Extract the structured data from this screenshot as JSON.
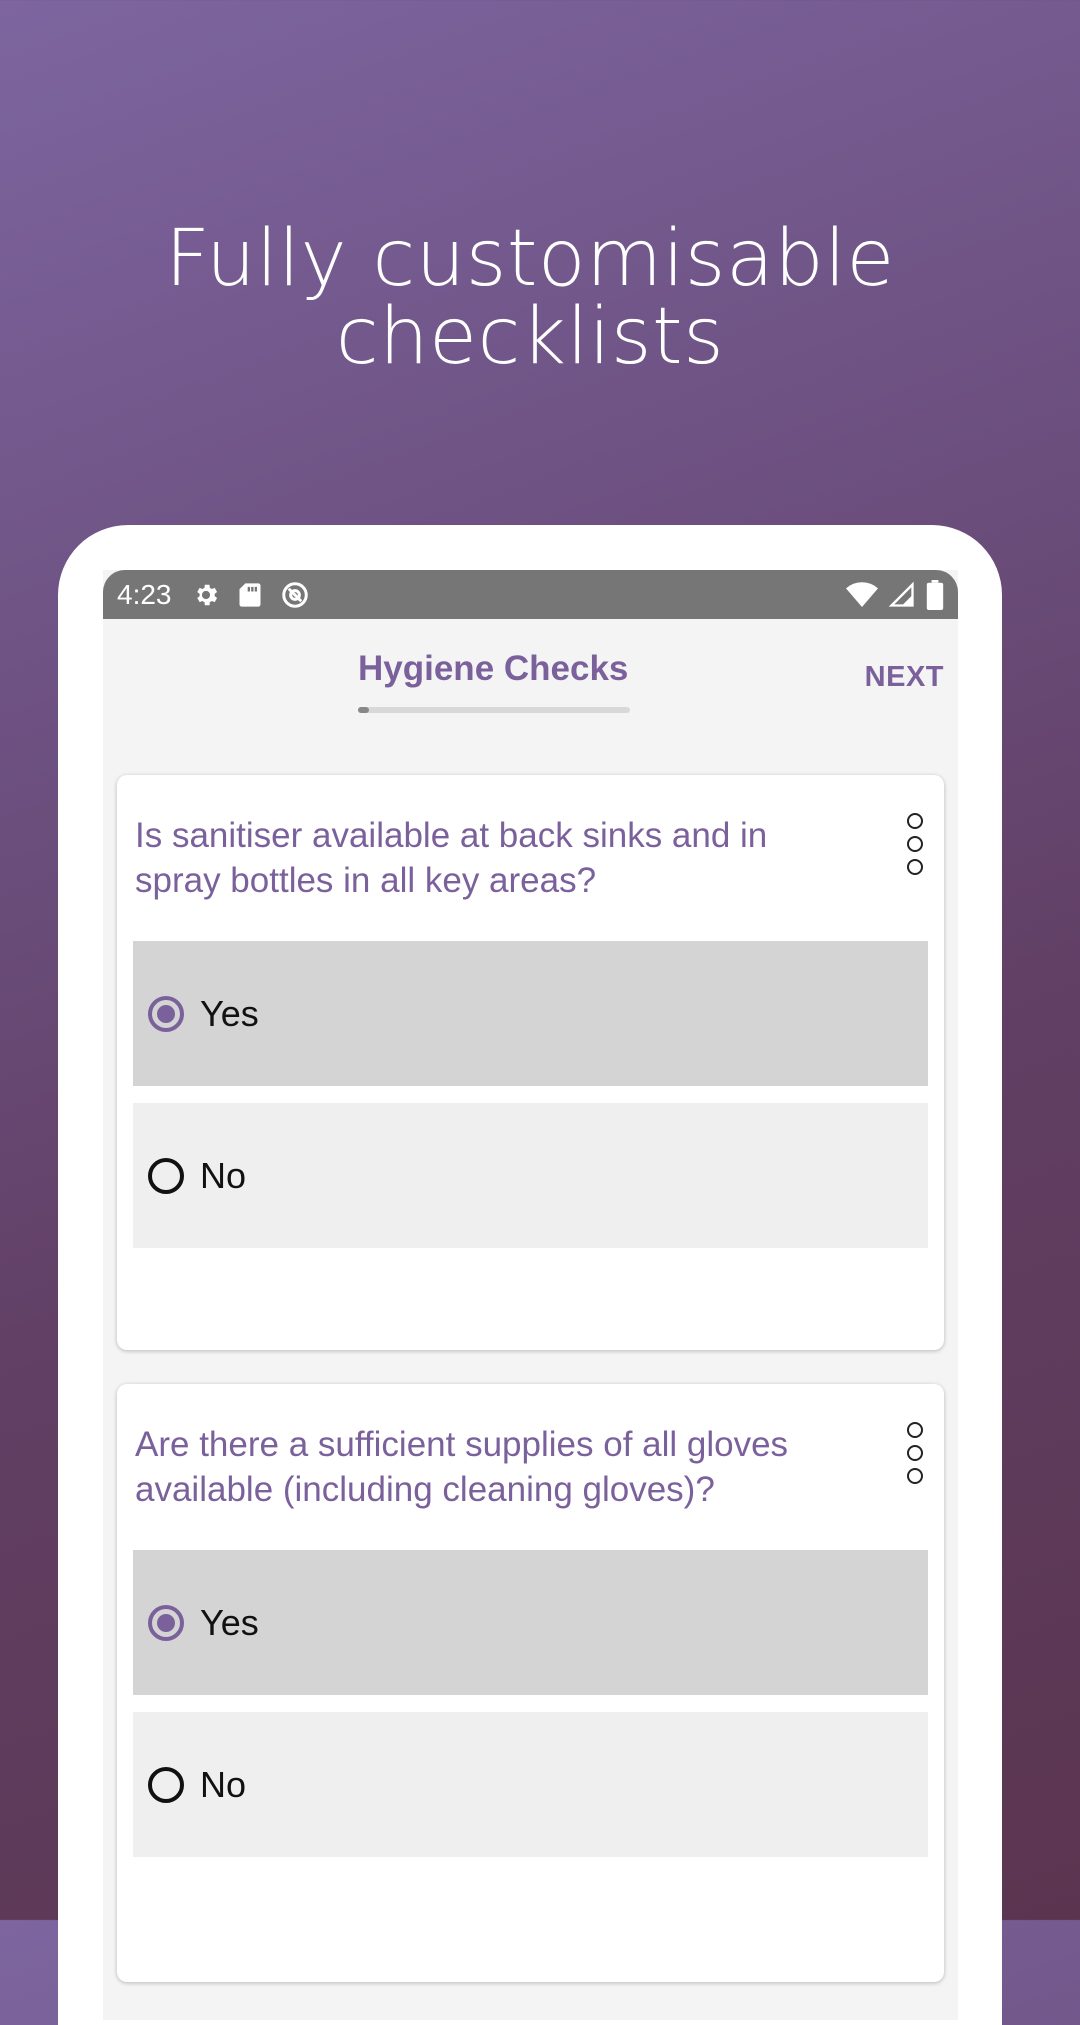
{
  "headline": {
    "line1": "Fully customisable",
    "line2": "checklists"
  },
  "statusbar": {
    "time": "4:23",
    "left_icons": [
      "settings-icon",
      "sd-card-icon",
      "at-sign-icon"
    ],
    "right_icons": [
      "wifi-icon",
      "cellular-signal-icon",
      "battery-icon"
    ]
  },
  "appbar": {
    "title": "Hygiene Checks",
    "next_label": "NEXT",
    "progress_fraction": 0.04
  },
  "questions": [
    {
      "text": "Is sanitiser available at back sinks and in spray bottles in all key areas?",
      "options": [
        {
          "label": "Yes",
          "selected": true
        },
        {
          "label": "No",
          "selected": false
        }
      ]
    },
    {
      "text": "Are there a sufficient supplies of all gloves available (including cleaning gloves)?",
      "options": [
        {
          "label": "Yes",
          "selected": true
        },
        {
          "label": "No",
          "selected": false
        }
      ]
    }
  ],
  "colors": {
    "accent": "#7b619c",
    "status_bar": "#767676",
    "selected_option": "#d4d4d4",
    "unselected_option": "#efefef"
  }
}
